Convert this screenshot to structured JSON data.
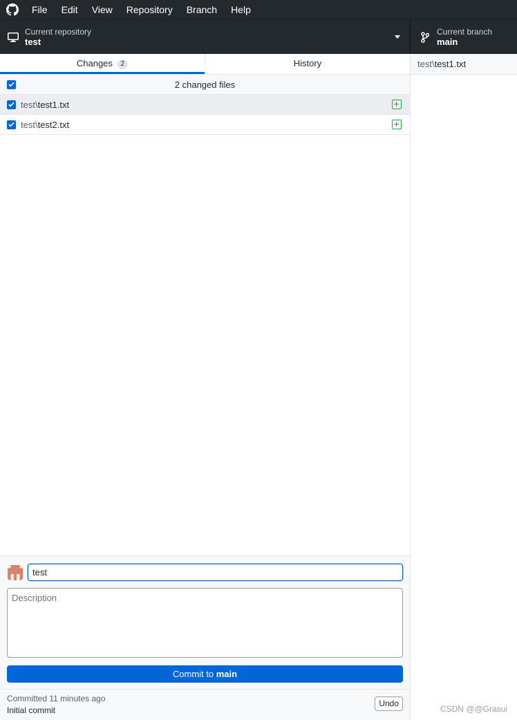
{
  "menubar": {
    "items": [
      "File",
      "Edit",
      "View",
      "Repository",
      "Branch",
      "Help"
    ]
  },
  "toolbar": {
    "repo_label": "Current repository",
    "repo_value": "test",
    "branch_label": "Current branch",
    "branch_value": "main"
  },
  "tabs": {
    "changes_label": "Changes",
    "changes_count": "2",
    "history_label": "History"
  },
  "changes": {
    "header_label": "2 changed files",
    "files": [
      {
        "dir": "test\\",
        "name": "test1.txt",
        "status": "added",
        "checked": true,
        "selected": true
      },
      {
        "dir": "test\\",
        "name": "test2.txt",
        "status": "added",
        "checked": true,
        "selected": false
      }
    ]
  },
  "commit": {
    "summary_value": "test",
    "description_placeholder": "Description",
    "button_prefix": "Commit to ",
    "button_branch": "main"
  },
  "last_commit": {
    "time_text": "Committed 11 minutes ago",
    "message": "Initial commit",
    "undo_label": "Undo"
  },
  "diff": {
    "file_dir": "test\\",
    "file_name": "test1.txt"
  },
  "watermark": "CSDN @@Grasui",
  "colors": {
    "accent": "#0366d6",
    "added": "#28a745",
    "titlebar": "#24292e"
  }
}
